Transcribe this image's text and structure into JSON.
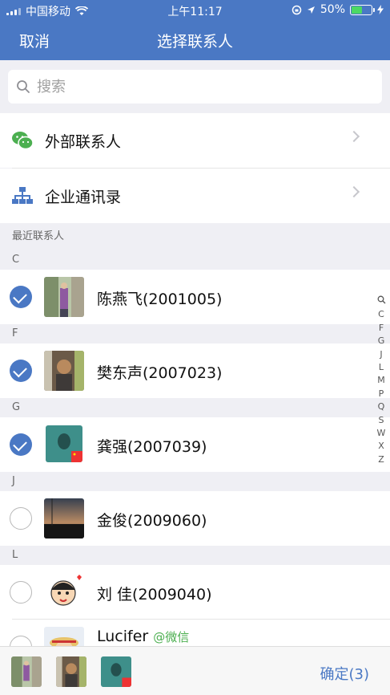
{
  "status": {
    "carrier": "中国移动",
    "time": "上午11:17",
    "battery": "50%"
  },
  "nav": {
    "cancel": "取消",
    "title": "选择联系人"
  },
  "search": {
    "placeholder": "搜索"
  },
  "entries": [
    {
      "label": "外部联系人",
      "icon": "wechat-icon"
    },
    {
      "label": "企业通讯录",
      "icon": "org-chart-icon"
    }
  ],
  "recent_header": "最近联系人",
  "groups": [
    {
      "letter": "C",
      "contacts": [
        {
          "name": "陈燕飞(2001005)",
          "checked": true
        }
      ]
    },
    {
      "letter": "F",
      "contacts": [
        {
          "name": "樊东声(2007023)",
          "checked": true
        }
      ]
    },
    {
      "letter": "G",
      "contacts": [
        {
          "name": "龚强(2007039)",
          "checked": true
        }
      ]
    },
    {
      "letter": "J",
      "contacts": [
        {
          "name": "金俊(2009060)",
          "checked": false
        }
      ]
    },
    {
      "letter": "L",
      "contacts": [
        {
          "name": "刘  佳(2009040)",
          "checked": false
        },
        {
          "name": "Lucifer",
          "tag": "@微信",
          "checked": false
        }
      ]
    }
  ],
  "index_letters": [
    "C",
    "F",
    "G",
    "J",
    "L",
    "M",
    "P",
    "Q",
    "S",
    "W",
    "X",
    "Z"
  ],
  "confirm": "确定(3)",
  "colors": {
    "brand": "#4a78c4",
    "wechat_green": "#4caf50",
    "background": "#efeff4"
  }
}
